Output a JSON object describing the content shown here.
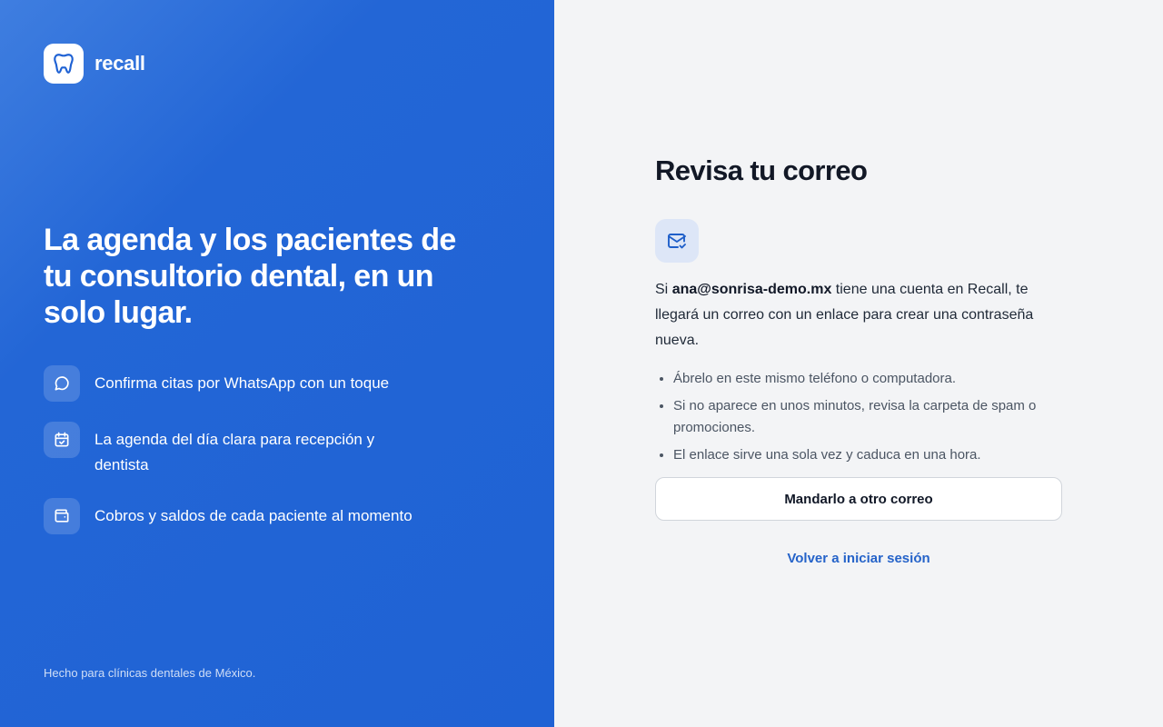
{
  "brand": {
    "name": "recall",
    "logo_icon": "tooth-icon"
  },
  "hero": {
    "headline": "La agenda y los pacientes de tu consultorio dental, en un solo lugar.",
    "features": [
      {
        "icon": "chat-bubble-icon",
        "text": "Confirma citas por WhatsApp con un toque"
      },
      {
        "icon": "calendar-check-icon",
        "text": "La agenda del día clara para recepción y dentista"
      },
      {
        "icon": "wallet-icon",
        "text": "Cobros y saldos de cada paciente al momento"
      }
    ],
    "footer": "Hecho para clínicas dentales de México."
  },
  "panel": {
    "title": "Revisa tu correo",
    "icon": "mail-check-icon",
    "message": {
      "prefix": "Si",
      "email": "ana@sonrisa-demo.mx",
      "suffix": "tiene una cuenta en Recall, te llegará un correo con un enlace para crear una contraseña nueva."
    },
    "tips": [
      "Ábrelo en este mismo teléfono o computadora.",
      "Si no aparece en unos minutos, revisa la carpeta de spam o promociones.",
      "El enlace sirve una sola vez y caduca en una hora."
    ],
    "resend_button": "Mandarlo a otro correo",
    "back_link": "Volver a iniciar sesión"
  },
  "colors": {
    "brand_blue": "#1f62d4",
    "link_blue": "#2563c9",
    "panel_bg": "#f3f4f6",
    "icon_badge_bg": "#dde6f7"
  }
}
